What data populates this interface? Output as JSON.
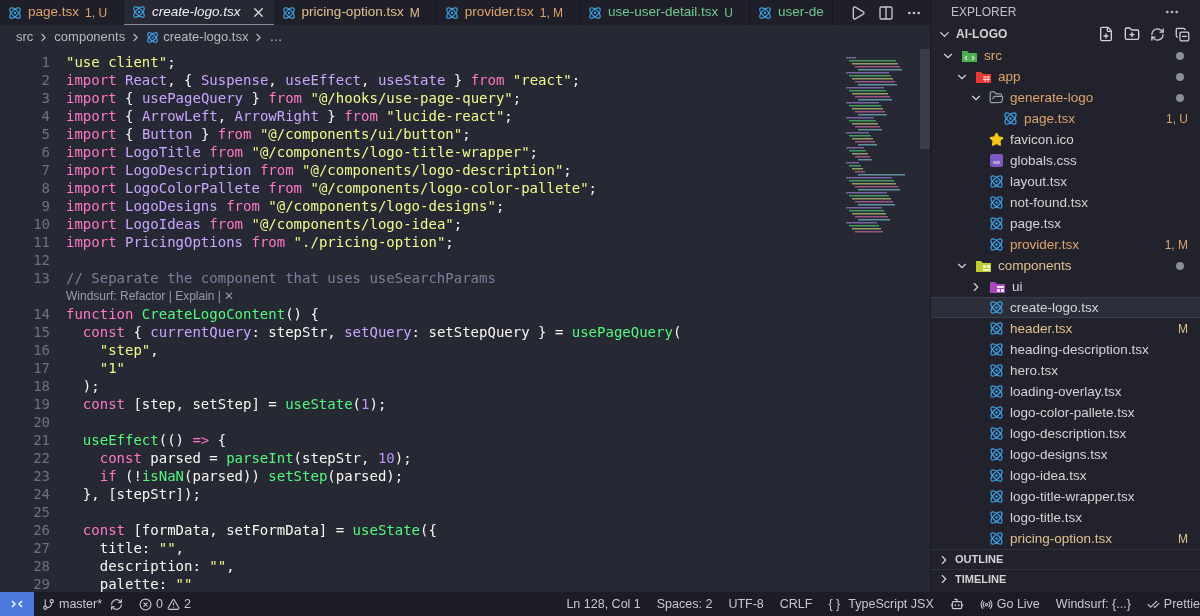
{
  "tabs": [
    {
      "label": "page.tsx",
      "badge": "1, U",
      "color": "#e0a46c",
      "selected": false,
      "preview": false
    },
    {
      "label": "create-logo.tsx",
      "color": "#f0f0f0",
      "selected": true,
      "preview": true
    },
    {
      "label": "pricing-option.tsx",
      "badge": "M",
      "color": "#e2c08d",
      "selected": false,
      "preview": false
    },
    {
      "label": "provider.tsx",
      "badge": "1, M",
      "color": "#e0a46c",
      "selected": false,
      "preview": false
    },
    {
      "label": "use-user-detail.tsx",
      "badge": "U",
      "color": "#73c991",
      "selected": false,
      "preview": false
    },
    {
      "label": "user-de",
      "color": "#73c991",
      "selected": false,
      "preview": false
    }
  ],
  "breadcrumb": [
    "src",
    "components",
    "create-logo.tsx",
    "…"
  ],
  "code": [
    {
      "kind": "code",
      "number": "1",
      "tokens": [
        {
          "kind": "str",
          "text": "\"use client\""
        },
        {
          "kind": "plain",
          "text": ";"
        }
      ]
    },
    {
      "kind": "code",
      "number": "2",
      "tokens": [
        {
          "kind": "kw",
          "text": "import "
        },
        {
          "kind": "var",
          "text": "React"
        },
        {
          "kind": "plain",
          "text": ", { "
        },
        {
          "kind": "var",
          "text": "Suspense"
        },
        {
          "kind": "plain",
          "text": ", "
        },
        {
          "kind": "var",
          "text": "useEffect"
        },
        {
          "kind": "plain",
          "text": ", "
        },
        {
          "kind": "var",
          "text": "useState"
        },
        {
          "kind": "plain",
          "text": " } "
        },
        {
          "kind": "kw",
          "text": "from "
        },
        {
          "kind": "str",
          "text": "\"react\""
        },
        {
          "kind": "plain",
          "text": ";"
        }
      ]
    },
    {
      "kind": "code",
      "number": "3",
      "tokens": [
        {
          "kind": "kw",
          "text": "import "
        },
        {
          "kind": "plain",
          "text": "{ "
        },
        {
          "kind": "var",
          "text": "usePageQuery"
        },
        {
          "kind": "plain",
          "text": " } "
        },
        {
          "kind": "kw",
          "text": "from "
        },
        {
          "kind": "str",
          "text": "\"@/hooks/use-page-query\""
        },
        {
          "kind": "plain",
          "text": ";"
        }
      ]
    },
    {
      "kind": "code",
      "number": "4",
      "tokens": [
        {
          "kind": "kw",
          "text": "import "
        },
        {
          "kind": "plain",
          "text": "{ "
        },
        {
          "kind": "var",
          "text": "ArrowLeft"
        },
        {
          "kind": "plain",
          "text": ", "
        },
        {
          "kind": "var",
          "text": "ArrowRight"
        },
        {
          "kind": "plain",
          "text": " } "
        },
        {
          "kind": "kw",
          "text": "from "
        },
        {
          "kind": "str",
          "text": "\"lucide-react\""
        },
        {
          "kind": "plain",
          "text": ";"
        }
      ]
    },
    {
      "kind": "code",
      "number": "5",
      "tokens": [
        {
          "kind": "kw",
          "text": "import "
        },
        {
          "kind": "plain",
          "text": "{ "
        },
        {
          "kind": "var",
          "text": "Button"
        },
        {
          "kind": "plain",
          "text": " } "
        },
        {
          "kind": "kw",
          "text": "from "
        },
        {
          "kind": "str",
          "text": "\"@/components/ui/button\""
        },
        {
          "kind": "plain",
          "text": ";"
        }
      ]
    },
    {
      "kind": "code",
      "number": "6",
      "tokens": [
        {
          "kind": "kw",
          "text": "import "
        },
        {
          "kind": "var",
          "text": "LogoTitle"
        },
        {
          "kind": "kw",
          "text": " from "
        },
        {
          "kind": "str",
          "text": "\"@/components/logo-title-wrapper\""
        },
        {
          "kind": "plain",
          "text": ";"
        }
      ]
    },
    {
      "kind": "code",
      "number": "7",
      "tokens": [
        {
          "kind": "kw",
          "text": "import "
        },
        {
          "kind": "var",
          "text": "LogoDescription"
        },
        {
          "kind": "kw",
          "text": " from "
        },
        {
          "kind": "str",
          "text": "\"@/components/logo-description\""
        },
        {
          "kind": "plain",
          "text": ";"
        }
      ]
    },
    {
      "kind": "code",
      "number": "8",
      "tokens": [
        {
          "kind": "kw",
          "text": "import "
        },
        {
          "kind": "var",
          "text": "LogoColorPallete"
        },
        {
          "kind": "kw",
          "text": " from "
        },
        {
          "kind": "str",
          "text": "\"@/components/logo-color-pallete\""
        },
        {
          "kind": "plain",
          "text": ";"
        }
      ]
    },
    {
      "kind": "code",
      "number": "9",
      "tokens": [
        {
          "kind": "kw",
          "text": "import "
        },
        {
          "kind": "var",
          "text": "LogoDesigns"
        },
        {
          "kind": "kw",
          "text": " from "
        },
        {
          "kind": "str",
          "text": "\"@/components/logo-designs\""
        },
        {
          "kind": "plain",
          "text": ";"
        }
      ]
    },
    {
      "kind": "code",
      "number": "10",
      "tokens": [
        {
          "kind": "kw",
          "text": "import "
        },
        {
          "kind": "var",
          "text": "LogoIdeas"
        },
        {
          "kind": "kw",
          "text": " from "
        },
        {
          "kind": "str",
          "text": "\"@/components/logo-idea\""
        },
        {
          "kind": "plain",
          "text": ";"
        }
      ]
    },
    {
      "kind": "code",
      "number": "11",
      "tokens": [
        {
          "kind": "kw",
          "text": "import "
        },
        {
          "kind": "var",
          "text": "PricingOptions"
        },
        {
          "kind": "kw",
          "text": " from "
        },
        {
          "kind": "str",
          "text": "\"./pricing-option\""
        },
        {
          "kind": "plain",
          "text": ";"
        }
      ]
    },
    {
      "kind": "code",
      "number": "12"
    },
    {
      "kind": "code",
      "number": "13",
      "tokens": [
        {
          "kind": "comment",
          "text": "// Separate the component that uses useSearchParams"
        }
      ]
    },
    {
      "kind": "codelens",
      "text": "Windsurf: Refactor | Explain | ✕"
    },
    {
      "kind": "code",
      "number": "14",
      "tokens": [
        {
          "kind": "kw",
          "text": "function "
        },
        {
          "kind": "fn",
          "text": "CreateLogoContent"
        },
        {
          "kind": "plain",
          "text": "() {"
        }
      ]
    },
    {
      "kind": "code",
      "number": "15",
      "tokens": [
        {
          "kind": "kw",
          "text": "  const "
        },
        {
          "kind": "plain",
          "text": "{ "
        },
        {
          "kind": "var",
          "text": "currentQuery"
        },
        {
          "kind": "plain",
          "text": ": stepStr, "
        },
        {
          "kind": "var",
          "text": "setQuery"
        },
        {
          "kind": "plain",
          "text": ": setStepQuery } = "
        },
        {
          "kind": "fn",
          "text": "usePageQuery"
        },
        {
          "kind": "plain",
          "text": "("
        }
      ]
    },
    {
      "kind": "code",
      "number": "16",
      "tokens": [
        {
          "kind": "str",
          "text": "    \"step\""
        },
        {
          "kind": "plain",
          "text": ","
        }
      ]
    },
    {
      "kind": "code",
      "number": "17",
      "tokens": [
        {
          "kind": "str",
          "text": "    \"1\""
        }
      ]
    },
    {
      "kind": "code",
      "number": "18",
      "tokens": [
        {
          "kind": "plain",
          "text": "  );"
        }
      ]
    },
    {
      "kind": "code",
      "number": "19",
      "tokens": [
        {
          "kind": "kw",
          "text": "  const "
        },
        {
          "kind": "plain",
          "text": "[step, setStep] = "
        },
        {
          "kind": "fn",
          "text": "useState"
        },
        {
          "kind": "plain",
          "text": "("
        },
        {
          "kind": "num",
          "text": "1"
        },
        {
          "kind": "plain",
          "text": ");"
        }
      ]
    },
    {
      "kind": "code",
      "number": "20"
    },
    {
      "kind": "code",
      "number": "21",
      "tokens": [
        {
          "kind": "fn",
          "text": "  useEffect"
        },
        {
          "kind": "plain",
          "text": "(() "
        },
        {
          "kind": "kw",
          "text": "=>"
        },
        {
          "kind": "plain",
          "text": " {"
        }
      ]
    },
    {
      "kind": "code",
      "number": "22",
      "tokens": [
        {
          "kind": "kw",
          "text": "    const "
        },
        {
          "kind": "plain",
          "text": "parsed = "
        },
        {
          "kind": "fn",
          "text": "parseInt"
        },
        {
          "kind": "plain",
          "text": "(stepStr, "
        },
        {
          "kind": "num",
          "text": "10"
        },
        {
          "kind": "plain",
          "text": ");"
        }
      ]
    },
    {
      "kind": "code",
      "number": "23",
      "tokens": [
        {
          "kind": "kw",
          "text": "    if "
        },
        {
          "kind": "plain",
          "text": "(!"
        },
        {
          "kind": "fn",
          "text": "isNaN"
        },
        {
          "kind": "plain",
          "text": "(parsed)) "
        },
        {
          "kind": "fn",
          "text": "setStep"
        },
        {
          "kind": "plain",
          "text": "(parsed);"
        }
      ]
    },
    {
      "kind": "code",
      "number": "24",
      "tokens": [
        {
          "kind": "plain",
          "text": "  }, [stepStr]);"
        }
      ]
    },
    {
      "kind": "code",
      "number": "25"
    },
    {
      "kind": "code",
      "number": "26",
      "tokens": [
        {
          "kind": "kw",
          "text": "  const "
        },
        {
          "kind": "plain",
          "text": "[formData, setFormData] = "
        },
        {
          "kind": "fn",
          "text": "useState"
        },
        {
          "kind": "plain",
          "text": "({"
        }
      ]
    },
    {
      "kind": "code",
      "number": "27",
      "tokens": [
        {
          "kind": "plain",
          "text": "    title: "
        },
        {
          "kind": "str",
          "text": "\"\""
        },
        {
          "kind": "plain",
          "text": ","
        }
      ]
    },
    {
      "kind": "code",
      "number": "28",
      "tokens": [
        {
          "kind": "plain",
          "text": "    description: "
        },
        {
          "kind": "str",
          "text": "\"\""
        },
        {
          "kind": "plain",
          "text": ","
        }
      ]
    },
    {
      "kind": "code",
      "number": "29",
      "tokens": [
        {
          "kind": "plain",
          "text": "    palette: "
        },
        {
          "kind": "str",
          "text": "\"\""
        }
      ]
    }
  ],
  "explorer": {
    "title": "EXPLORER",
    "project": "AI-LOGO",
    "tree": [
      {
        "name": "src",
        "kind": "folder-src",
        "expanded": true,
        "color": "#e0a46c",
        "dot": true,
        "selected": false,
        "children": [
          {
            "name": "app",
            "kind": "folder-app",
            "expanded": true,
            "color": "#e0a46c",
            "dot": true,
            "selected": false,
            "children": [
              {
                "name": "generate-logo",
                "kind": "folder",
                "expanded": true,
                "color": "#e0a46c",
                "dot": true,
                "selected": false,
                "children": [
                  {
                    "name": "page.tsx",
                    "kind": "react",
                    "color": "#e0a46c",
                    "badge": "1, U",
                    "selected": false
                  }
                ]
              },
              {
                "name": "favicon.ico",
                "kind": "star",
                "color": "#d4d4d4",
                "selected": false
              },
              {
                "name": "globals.css",
                "kind": "css",
                "color": "#d4d4d4",
                "selected": false
              },
              {
                "name": "layout.tsx",
                "kind": "react",
                "color": "#d4d4d4",
                "selected": false
              },
              {
                "name": "not-found.tsx",
                "kind": "react",
                "color": "#d4d4d4",
                "selected": false
              },
              {
                "name": "page.tsx",
                "kind": "react",
                "color": "#d4d4d4",
                "selected": false
              },
              {
                "name": "provider.tsx",
                "kind": "react",
                "color": "#e0a46c",
                "badge": "1, M",
                "selected": false
              }
            ]
          },
          {
            "name": "components",
            "kind": "folder-components",
            "expanded": true,
            "color": "#e2c08d",
            "dot": true,
            "selected": false,
            "children": [
              {
                "name": "ui",
                "kind": "folder-ui",
                "expanded": false,
                "color": "#d4d4d4",
                "dot": false,
                "selected": false
              },
              {
                "name": "create-logo.tsx",
                "kind": "react",
                "color": "#d4d4d4",
                "selected": true
              },
              {
                "name": "header.tsx",
                "kind": "react",
                "color": "#e2c08d",
                "badge": "M",
                "selected": false
              },
              {
                "name": "heading-description.tsx",
                "kind": "react",
                "color": "#d4d4d4",
                "selected": false
              },
              {
                "name": "hero.tsx",
                "kind": "react",
                "color": "#d4d4d4",
                "selected": false
              },
              {
                "name": "loading-overlay.tsx",
                "kind": "react",
                "color": "#d4d4d4",
                "selected": false
              },
              {
                "name": "logo-color-pallete.tsx",
                "kind": "react",
                "color": "#d4d4d4",
                "selected": false
              },
              {
                "name": "logo-description.tsx",
                "kind": "react",
                "color": "#d4d4d4",
                "selected": false
              },
              {
                "name": "logo-designs.tsx",
                "kind": "react",
                "color": "#d4d4d4",
                "selected": false
              },
              {
                "name": "logo-idea.tsx",
                "kind": "react",
                "color": "#d4d4d4",
                "selected": false
              },
              {
                "name": "logo-title-wrapper.tsx",
                "kind": "react",
                "color": "#d4d4d4",
                "selected": false
              },
              {
                "name": "logo-title.tsx",
                "kind": "react",
                "color": "#d4d4d4",
                "selected": false
              },
              {
                "name": "pricing-option.tsx",
                "kind": "react",
                "color": "#e2c08d",
                "badge": "M",
                "selected": false
              }
            ]
          }
        ]
      }
    ],
    "sections": [
      {
        "label": "OUTLINE",
        "expanded": false
      },
      {
        "label": "TIMELINE",
        "expanded": false
      }
    ]
  },
  "status_bar": {
    "branch": "master*",
    "errors": "0",
    "warnings": "2",
    "items": [
      {
        "kind": "text",
        "text": "Ln 128, Col 1"
      },
      {
        "kind": "text",
        "text": "Spaces: 2"
      },
      {
        "kind": "text",
        "text": "UTF-8"
      },
      {
        "kind": "text",
        "text": "CRLF"
      },
      {
        "kind": "language",
        "icon_text": "{ }",
        "text": "TypeScript JSX"
      },
      {
        "kind": "bot"
      },
      {
        "kind": "live",
        "text": "Go Live"
      },
      {
        "kind": "text",
        "text": "Windsurf: {...}"
      },
      {
        "kind": "check",
        "text": "Prettie"
      }
    ]
  }
}
